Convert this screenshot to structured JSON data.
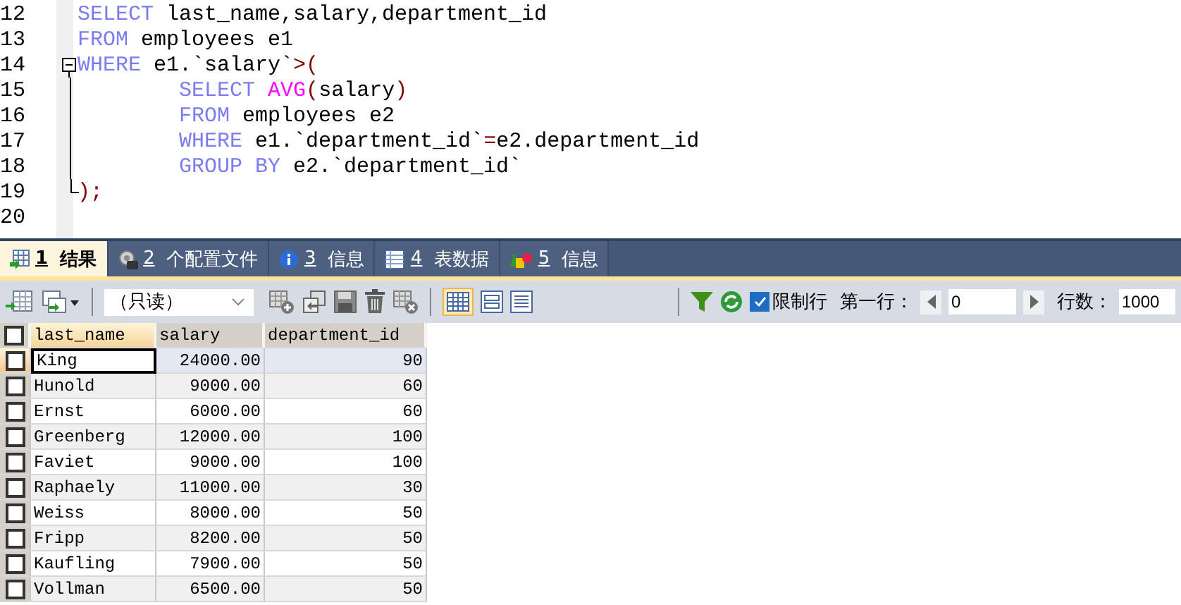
{
  "editor": {
    "lines": [
      {
        "number": "12",
        "kind": "plain",
        "tokens": [
          {
            "kind": "keyword",
            "text": "SELECT"
          },
          {
            "kind": "plain",
            "text": " last_name,salary,department_id"
          }
        ]
      },
      {
        "number": "13",
        "kind": "plain",
        "tokens": [
          {
            "kind": "keyword",
            "text": "FROM"
          },
          {
            "kind": "plain",
            "text": " employees e1"
          }
        ]
      },
      {
        "number": "14",
        "kind": "fold_start",
        "tokens": [
          {
            "kind": "keyword",
            "text": "WHERE"
          },
          {
            "kind": "plain",
            "text": " e1.`salary`"
          },
          {
            "kind": "punct",
            "text": ">("
          }
        ]
      },
      {
        "number": "15",
        "kind": "fold_line",
        "tokens": [
          {
            "kind": "keyword",
            "text": "        SELECT"
          },
          {
            "kind": "function",
            "text": " AVG"
          },
          {
            "kind": "punct",
            "text": "("
          },
          {
            "kind": "plain",
            "text": "salary"
          },
          {
            "kind": "punct",
            "text": ")"
          }
        ]
      },
      {
        "number": "16",
        "kind": "fold_line",
        "tokens": [
          {
            "kind": "keyword",
            "text": "        FROM"
          },
          {
            "kind": "plain",
            "text": " employees e2"
          }
        ]
      },
      {
        "number": "17",
        "kind": "fold_line",
        "tokens": [
          {
            "kind": "keyword",
            "text": "        WHERE"
          },
          {
            "kind": "plain",
            "text": " e1.`department_id`"
          },
          {
            "kind": "punct",
            "text": "="
          },
          {
            "kind": "plain",
            "text": "e2.department_id"
          }
        ]
      },
      {
        "number": "18",
        "kind": "fold_line",
        "tokens": [
          {
            "kind": "keyword",
            "text": "        GROUP BY"
          },
          {
            "kind": "plain",
            "text": " e2.`department_id`"
          }
        ]
      },
      {
        "number": "19",
        "kind": "fold_end",
        "tokens": [
          {
            "kind": "punct",
            "text": ");"
          }
        ]
      },
      {
        "number": "20",
        "kind": "plain"
      }
    ]
  },
  "tabs": [
    {
      "number": "1",
      "label": "结果",
      "selected": true
    },
    {
      "number": "2",
      "label": "个配置文件",
      "selected": false
    },
    {
      "number": "3",
      "label": "信息",
      "selected": false
    },
    {
      "number": "4",
      "label": "表数据",
      "selected": false
    },
    {
      "number": "5",
      "label": "信息",
      "selected": false
    }
  ],
  "toolbar": {
    "mode_select": "（只读）",
    "limit_rows": {
      "label": "限制行",
      "checked": true
    },
    "first_row": {
      "label": "第一行：",
      "value": "0"
    },
    "row_count": {
      "label": "行数：",
      "value": "1000"
    }
  },
  "table": {
    "select_all": {
      "checked": false
    },
    "columns": [
      "last_name",
      "salary",
      "department_id"
    ],
    "rows": [
      {
        "selected": true,
        "checked": false,
        "cells": [
          "King",
          "24000.00",
          "90"
        ]
      },
      {
        "selected": false,
        "checked": false,
        "cells": [
          "Hunold",
          "9000.00",
          "60"
        ]
      },
      {
        "selected": false,
        "checked": false,
        "cells": [
          "Ernst",
          "6000.00",
          "60"
        ]
      },
      {
        "selected": false,
        "checked": false,
        "cells": [
          "Greenberg",
          "12000.00",
          "100"
        ]
      },
      {
        "selected": false,
        "checked": false,
        "cells": [
          "Faviet",
          "9000.00",
          "100"
        ]
      },
      {
        "selected": false,
        "checked": false,
        "cells": [
          "Raphaely",
          "11000.00",
          "30"
        ]
      },
      {
        "selected": false,
        "checked": false,
        "cells": [
          "Weiss",
          "8000.00",
          "50"
        ]
      },
      {
        "selected": false,
        "checked": false,
        "cells": [
          "Fripp",
          "8200.00",
          "50"
        ]
      },
      {
        "selected": false,
        "checked": false,
        "cells": [
          "Kaufling",
          "7900.00",
          "50"
        ]
      },
      {
        "selected": false,
        "checked": false,
        "cells": [
          "Vollman",
          "6500.00",
          "50"
        ]
      }
    ]
  }
}
